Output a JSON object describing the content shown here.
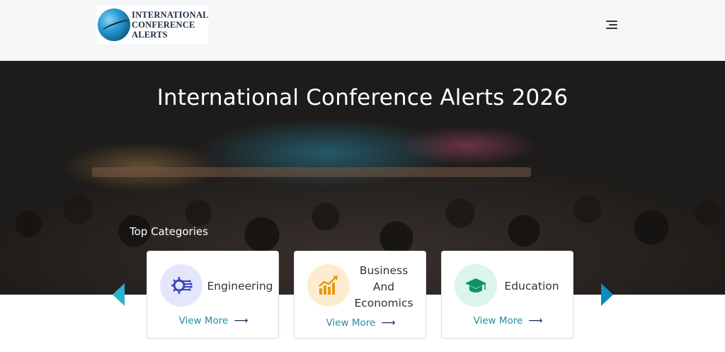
{
  "header": {
    "logo_lines": [
      "INTERNATIONAL",
      "CONFERENCE",
      "ALERTS"
    ],
    "menu_icon": "hamburger-menu-icon"
  },
  "hero": {
    "title": "International Conference Alerts 2026",
    "section_label": "Top Categories"
  },
  "categories": [
    {
      "label": "Engineering",
      "icon": "engineering-circuit-icon",
      "icon_bg": "#e4e6fb",
      "icon_color": "#3a46b8",
      "more": "View More",
      "more_arrow": "⟶"
    },
    {
      "label_lines": [
        "Business",
        "And",
        "Economics"
      ],
      "icon": "growth-chart-icon",
      "icon_bg": "#fdecd0",
      "icon_color": "#e59a12",
      "more": "View More",
      "more_arrow": "⟶"
    },
    {
      "label": "Education",
      "icon": "graduation-cap-icon",
      "icon_bg": "#d9f5ec",
      "icon_color": "#0f8f6a",
      "more": "View More",
      "more_arrow": "⟶"
    }
  ],
  "carousel": {
    "prev_icon": "chevron-left-icon",
    "next_icon": "chevron-right-icon",
    "prev_color": "#2ab3d1",
    "next_color": "#0a8ebd"
  }
}
